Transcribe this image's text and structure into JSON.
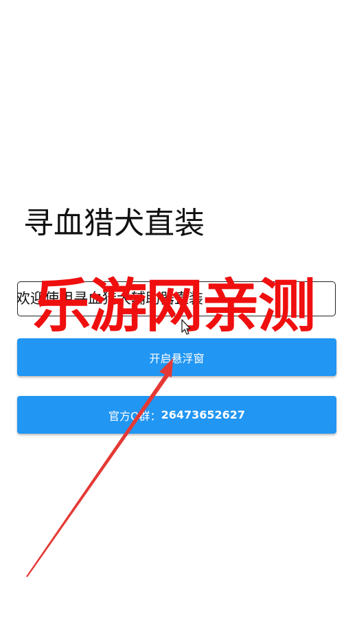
{
  "app": {
    "title": "寻血猎犬直装",
    "marquee_text": "欢迎使用寻血猎犬辅助器直装",
    "buttons": {
      "float_window_label": "开启悬浮窗",
      "qq_group_prefix": "官方Q群：",
      "qq_group_number": "26473652627"
    }
  },
  "overlay": {
    "watermark_text": "乐游网亲测",
    "watermark_color": "#f00f0f",
    "arrow_color": "#e53935",
    "pointer_icon": "mouse-pointer-icon"
  },
  "colors": {
    "button_blue": "#2196f3",
    "background": "#ffffff",
    "text": "#111111"
  }
}
